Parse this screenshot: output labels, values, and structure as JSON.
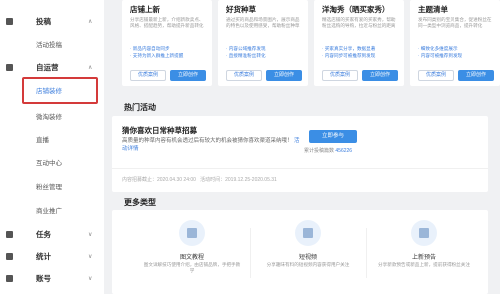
{
  "sidebar": {
    "groups": [
      {
        "label": "投稿",
        "icon": "document-icon"
      },
      {
        "label": "自运营",
        "icon": "megaphone-icon"
      },
      {
        "label": "任务",
        "icon": "task-icon"
      },
      {
        "label": "统计",
        "icon": "chart-icon"
      },
      {
        "label": "账号",
        "icon": "user-icon"
      }
    ],
    "items": [
      {
        "label": "活动投稿"
      },
      {
        "label": "店铺装修"
      },
      {
        "label": "微淘装修"
      },
      {
        "label": "直播"
      },
      {
        "label": "互动中心"
      },
      {
        "label": "粉丝管理"
      },
      {
        "label": "商业推广"
      }
    ]
  },
  "cards": [
    {
      "title": "店铺上新",
      "desc": "分享店铺最新上新，介绍新款卖点、风格、搭配趋势，帮助提升新品转化",
      "bullets": [
        "· 新品内容自动同步",
        "· 支持为新入群推上新提醒"
      ],
      "btn_case": "优质案例",
      "btn_create": "立即创作"
    },
    {
      "title": "好货种草",
      "desc": "通过买的商品和场景图片，展示商品的特色以及使用感受，帮助粉丝种草",
      "bullets": [
        "· 内容公域推荐发现",
        "· 直接精准粉丝转化"
      ],
      "btn_case": "优质案例",
      "btn_create": "立即创作"
    },
    {
      "title": "洋淘秀（晒买家秀）",
      "desc": "精选店铺的买家有爱的买家秀，帮助粉丝选购的导购，拉近与粉丝的距离",
      "bullets": [
        "· 买家真实分享，数据显著",
        "· 内容同步可被推荐到发现"
      ],
      "btn_case": "优质案例",
      "btn_create": "立即创作"
    },
    {
      "title": "主题清单",
      "desc": "发布同类别的宝贝集合，促进粉丝在同一类型中浏览商品，提升转化",
      "bullets": [
        "· 细致化多维度展示",
        "· 内容可被推荐到发现"
      ],
      "btn_case": "优质案例",
      "btn_create": "立即创作"
    }
  ],
  "hot": {
    "section_title": "热门活动",
    "title": "猜你喜欢日常种草招募",
    "desc": "高质量的种草内容有机会透过后有较大的机会被猜你喜欢渠道采纳哦！",
    "link": "活动详情",
    "join": "立即参与",
    "count_label": "累计投稿篇数",
    "count": "456226",
    "deadline": "内容招募截止：2020.04.30 24:00",
    "period": "活动时间：2019.12.25-2020.05.31"
  },
  "more": {
    "section_title": "更多类型",
    "types": [
      {
        "title": "图文教程",
        "desc": "图文详解技巧使用介绍，由店铺品牌，手把手教学",
        "icon": "article-icon"
      },
      {
        "title": "短视频",
        "desc": "分享趣味有料的短视频内容获得用户关注",
        "icon": "video-icon"
      },
      {
        "title": "上新预告",
        "desc": "分享新款预告或新品上新，提前获得粉丝关注",
        "icon": "calendar-icon"
      }
    ]
  }
}
